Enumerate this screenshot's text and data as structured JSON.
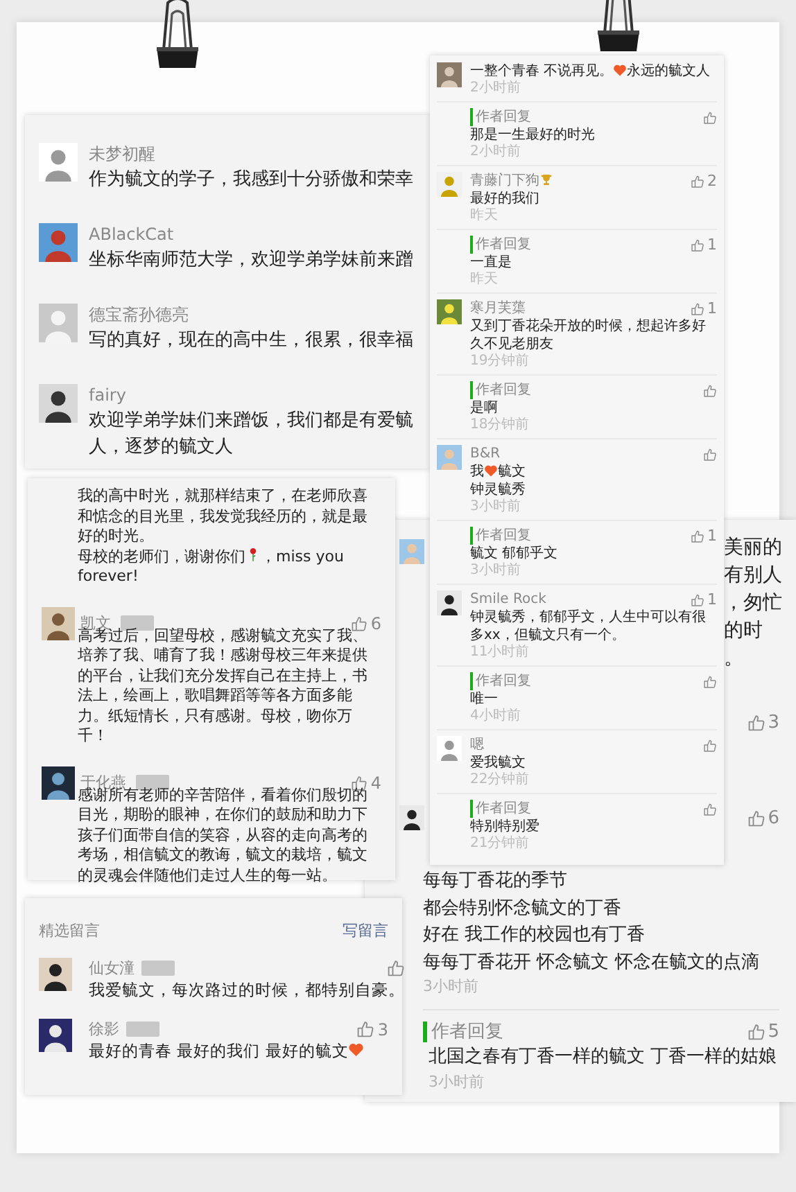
{
  "top_left_card": {
    "comments": [
      {
        "name": "未梦初醒",
        "lines": [
          "作为毓文的学子，我感到十分骄傲和荣幸"
        ]
      },
      {
        "name": "ABlackCat",
        "lines": [
          "坐标华南师范大学，欢迎学弟学妹前来蹭"
        ]
      },
      {
        "name": "德宝斋孙德亮",
        "lines": [
          "写的真好，现在的高中生，很累，很幸福"
        ]
      },
      {
        "name": "fairy",
        "lines": [
          "欢迎学弟学妹们来蹭饭，我们都是有爱毓",
          "人，逐梦的毓文人"
        ]
      }
    ]
  },
  "middle_left_card": {
    "paragraphs": [
      [
        {
          "kind": "text",
          "text": "我的高中时光，就那样结束了，在老师欣喜和惦念的目光里，我发觉我经历的，就是最好的时光。"
        }
      ],
      [
        {
          "kind": "text",
          "text": "母校的老师们，谢谢你们"
        },
        {
          "kind": "rose"
        },
        {
          "kind": "text",
          "text": "，miss you"
        },
        {
          "kind": "break"
        },
        {
          "kind": "text",
          "text": "forever!"
        }
      ]
    ],
    "comments": [
      {
        "name": "凯文",
        "tagged": true,
        "likes": "6",
        "text": "高考过后，回望母校，感谢毓文充实了我、培养了我、哺育了我！感谢母校三年来提供的平台，让我们充分发挥自己在主持上，书法上，绘画上，歌唱舞蹈等等各方面多能力。纸短情长，只有感谢。母校，吻你万千！"
      },
      {
        "name": "于化燕",
        "tagged": true,
        "likes": "4",
        "text": "感谢所有老师的辛苦陪伴，看着你们殷切的目光，期盼的眼神，在你们的鼓励和助力下孩子们面带自信的笑容，从容的走向高考的考场，相信毓文的教诲，毓文的栽培，毓文的灵魂会伴随他们走过人生的每一站。"
      }
    ]
  },
  "bottom_left_card": {
    "section_title": "精选留言",
    "write_link": "写留言",
    "comments": [
      {
        "name": "仙女潼",
        "tagged": true,
        "parts": [
          {
            "kind": "text",
            "text": "我爱毓文，每次路过的时候，都特别自豪。"
          }
        ]
      },
      {
        "name": "徐影",
        "tagged": true,
        "likes": "3",
        "parts": [
          {
            "kind": "text",
            "text": "最好的青春 最好的我们 最好的毓文"
          },
          {
            "kind": "heart"
          }
        ]
      }
    ]
  },
  "bottom_right_card": {
    "fragments": [
      "美丽的",
      "有别人",
      "，匆忙",
      "的时",
      "。"
    ],
    "reply_likes": "3",
    "comment_likes": "6",
    "lines": [
      "每每丁香花的季节",
      "都会特别怀念毓文的丁香",
      "好在 我工作的校园也有丁香",
      "每每丁香花开 怀念毓文 怀念在毓文的点滴"
    ],
    "time": "3小时前",
    "reply": {
      "label": "作者回复",
      "likes": "5",
      "text": "北国之春有丁香一样的毓文 丁香一样的姑娘",
      "time": "3小时前"
    }
  },
  "top_right_card": {
    "items": [
      {
        "kind": "comment",
        "parts": [
          {
            "kind": "text",
            "text": "一整个青春 不说再见。"
          },
          {
            "kind": "heart"
          },
          {
            "kind": "text",
            "text": "永远的毓文人"
          }
        ],
        "time": "2小时前"
      },
      {
        "kind": "reply",
        "label": "作者回复",
        "parts": [
          {
            "kind": "text",
            "text": "那是一生最好的时光"
          }
        ],
        "time": "2小时前"
      },
      {
        "kind": "comment",
        "name_parts": [
          {
            "kind": "text",
            "text": "青藤门下狗"
          },
          {
            "kind": "trophy"
          }
        ],
        "likes": "2",
        "parts": [
          {
            "kind": "text",
            "text": "最好的我们"
          }
        ],
        "time": "昨天"
      },
      {
        "kind": "reply",
        "label": "作者回复",
        "likes": "1",
        "parts": [
          {
            "kind": "text",
            "text": "一直是"
          }
        ],
        "time": "昨天"
      },
      {
        "kind": "comment",
        "name_parts": [
          {
            "kind": "text",
            "text": "寒月芙蕖"
          }
        ],
        "likes": "1",
        "parts": [
          {
            "kind": "text",
            "text": "又到丁香花朵开放的时候，想起许多好久不见老朋友"
          }
        ],
        "time": "19分钟前"
      },
      {
        "kind": "reply",
        "label": "作者回复",
        "parts": [
          {
            "kind": "text",
            "text": "是啊"
          }
        ],
        "time": "18分钟前"
      },
      {
        "kind": "comment",
        "name_parts": [
          {
            "kind": "text",
            "text": "B&R"
          }
        ],
        "parts": [
          {
            "kind": "text",
            "text": "我"
          },
          {
            "kind": "heart"
          },
          {
            "kind": "text",
            "text": "毓文"
          },
          {
            "kind": "break"
          },
          {
            "kind": "text",
            "text": "钟灵毓秀"
          }
        ],
        "time": "3小时前"
      },
      {
        "kind": "reply",
        "label": "作者回复",
        "likes": "1",
        "parts": [
          {
            "kind": "text",
            "text": "毓文 郁郁乎文"
          }
        ],
        "time": "3小时前"
      },
      {
        "kind": "comment",
        "name_parts": [
          {
            "kind": "text",
            "text": "Smile Rock"
          }
        ],
        "likes": "1",
        "parts": [
          {
            "kind": "text",
            "text": "钟灵毓秀，郁郁乎文，人生中可以有很多xx，但毓文只有一个。"
          }
        ],
        "time": "11小时前"
      },
      {
        "kind": "reply",
        "label": "作者回复",
        "parts": [
          {
            "kind": "text",
            "text": "唯一"
          }
        ],
        "time": "4小时前"
      },
      {
        "kind": "comment",
        "name_parts": [
          {
            "kind": "text",
            "text": "嗯"
          }
        ],
        "parts": [
          {
            "kind": "text",
            "text": "爱我毓文"
          }
        ],
        "time": "22分钟前"
      },
      {
        "kind": "reply",
        "label": "作者回复",
        "parts": [
          {
            "kind": "text",
            "text": "特别特别爱"
          }
        ],
        "time": "21分钟前"
      }
    ]
  }
}
